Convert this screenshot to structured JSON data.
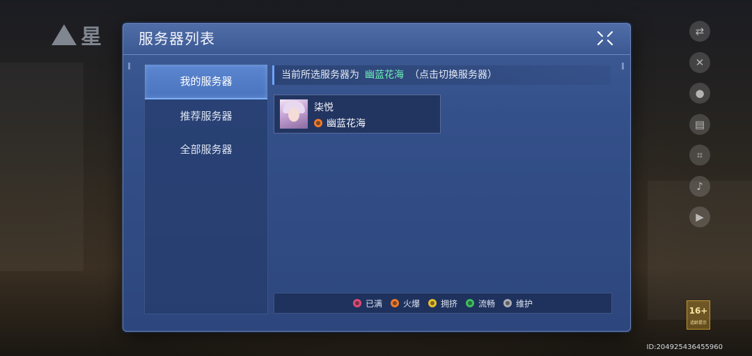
{
  "background": {
    "logo_text": "星",
    "id_text": "ID:204925436455960",
    "age_badge": {
      "rating": "16+",
      "caption": "适龄提示"
    },
    "side_icons": [
      "translate-icon",
      "tools-icon",
      "user-icon",
      "calendar-icon",
      "scan-icon",
      "mic-icon",
      "video-icon"
    ]
  },
  "dialog": {
    "title": "服务器列表",
    "close_icon": "close-icon"
  },
  "sidebar": {
    "items": [
      {
        "label": "我的服务器",
        "active": true
      },
      {
        "label": "推荐服务器",
        "active": false
      },
      {
        "label": "全部服务器",
        "active": false
      }
    ]
  },
  "current": {
    "prefix": "当前所选服务器为",
    "server_name": "幽蓝花海",
    "suffix": "（点击切换服务器）"
  },
  "server_card": {
    "character_name": "柒悦",
    "server_name": "幽蓝花海",
    "status": "火爆"
  },
  "legend": {
    "items": [
      {
        "label": "已满",
        "color": "#e04a78"
      },
      {
        "label": "火爆",
        "color": "#f07a2a"
      },
      {
        "label": "拥挤",
        "color": "#e8c02a"
      },
      {
        "label": "流畅",
        "color": "#3cc060"
      },
      {
        "label": "维护",
        "color": "#a8acb4"
      }
    ]
  },
  "colors": {
    "accent_green": "#6ff0b8",
    "active_tab": "#4a74bd"
  }
}
